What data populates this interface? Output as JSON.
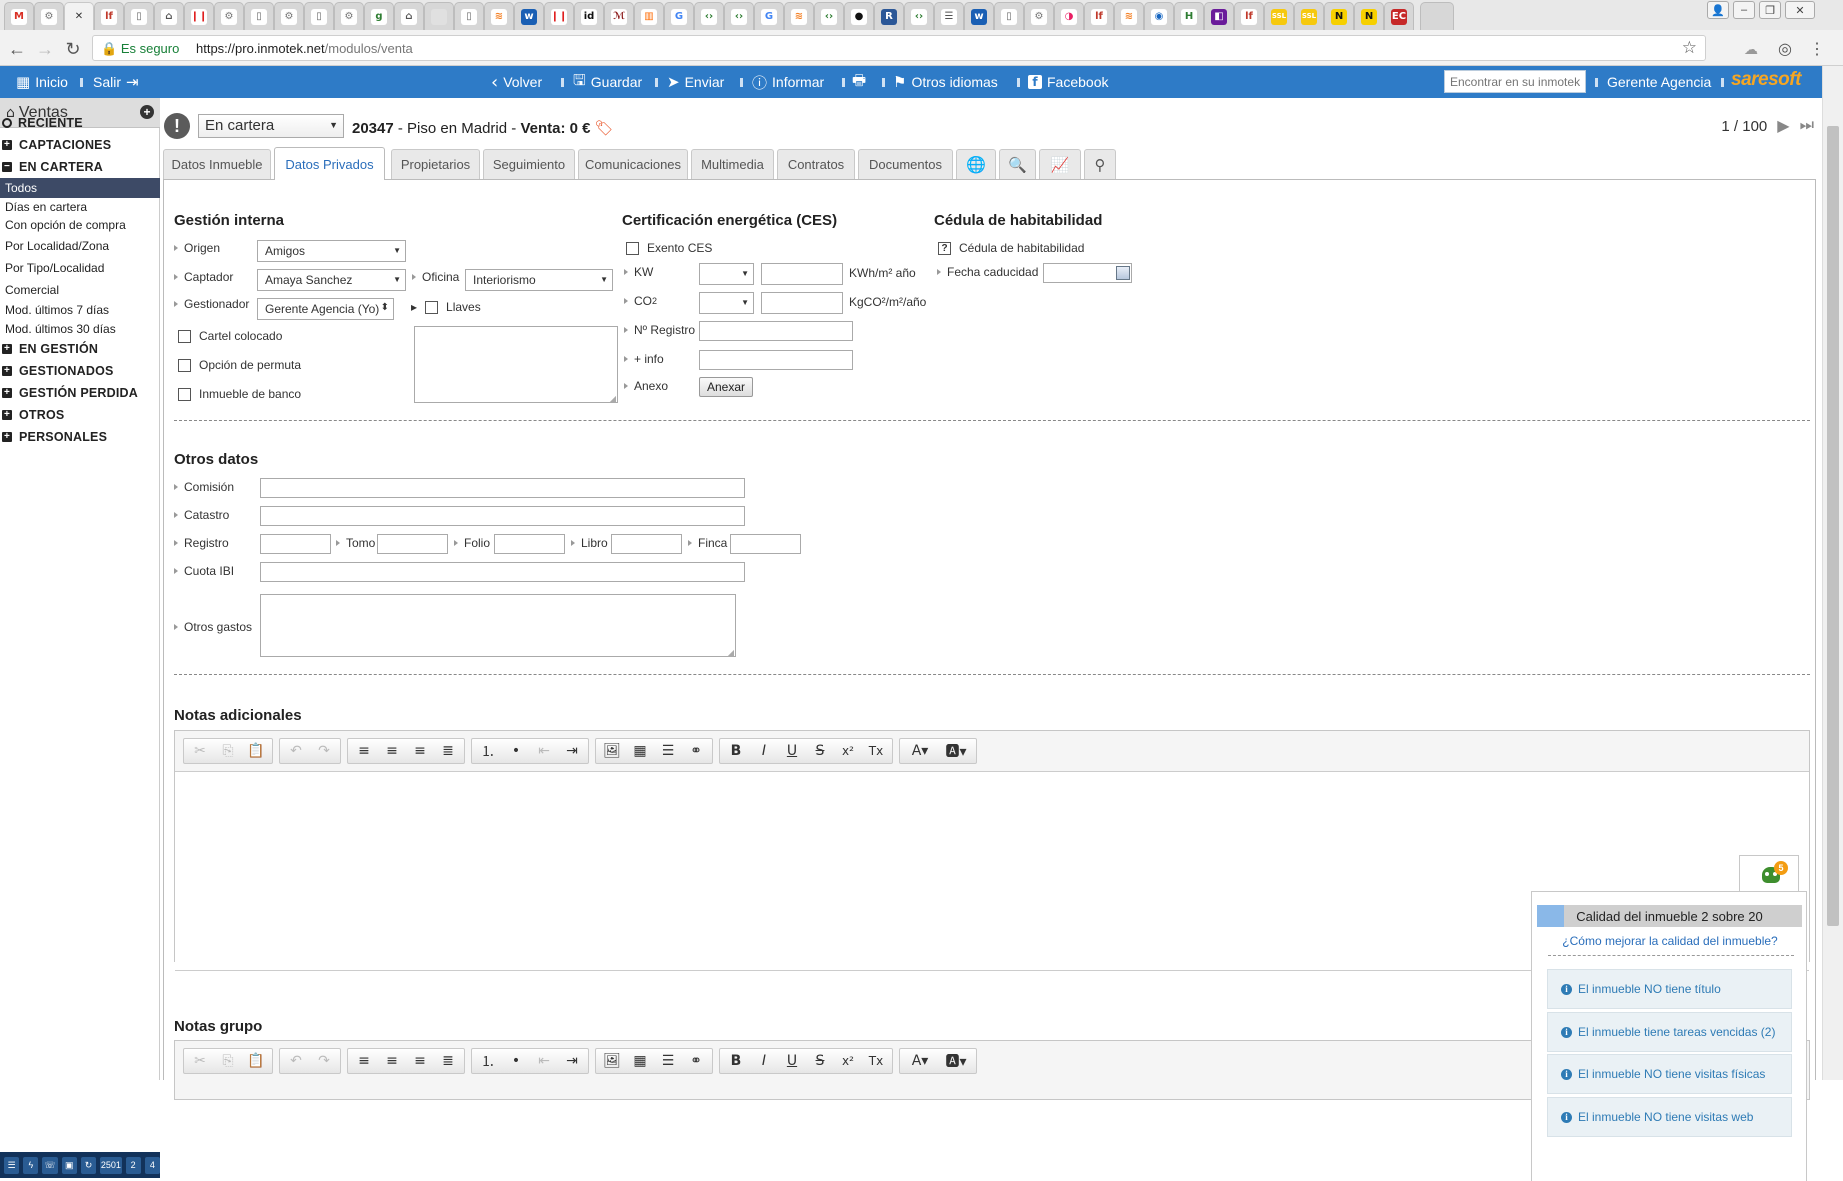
{
  "browser": {
    "tabs": [
      {
        "glyph": "M",
        "bg": "#ffffff",
        "fg": "#d93025"
      },
      {
        "glyph": "⚙",
        "bg": "#ffffff",
        "fg": "#777777"
      },
      {
        "glyph": "✕",
        "bg": "#f2f2f2",
        "fg": "#333333",
        "active": true
      },
      {
        "glyph": "lf",
        "bg": "#ffffff",
        "fg": "#c0392b"
      },
      {
        "glyph": "▯",
        "bg": "#ffffff",
        "fg": "#666666"
      },
      {
        "glyph": "⌂",
        "bg": "#ffffff",
        "fg": "#555555"
      },
      {
        "glyph": "❙❙",
        "bg": "#ffffff",
        "fg": "#e02020"
      },
      {
        "glyph": "⚙",
        "bg": "#ffffff",
        "fg": "#777777"
      },
      {
        "glyph": "▯",
        "bg": "#ffffff",
        "fg": "#666666"
      },
      {
        "glyph": "⚙",
        "bg": "#ffffff",
        "fg": "#777777"
      },
      {
        "glyph": "▯",
        "bg": "#ffffff",
        "fg": "#666666"
      },
      {
        "glyph": "⚙",
        "bg": "#ffffff",
        "fg": "#777777"
      },
      {
        "glyph": "g",
        "bg": "#ffffff",
        "fg": "#2e7d32"
      },
      {
        "glyph": "⌂",
        "bg": "#ffffff",
        "fg": "#555555"
      },
      {
        "glyph": " ",
        "bg": "#e0e0e0",
        "fg": "#555555"
      },
      {
        "glyph": "▯",
        "bg": "#ffffff",
        "fg": "#666666"
      },
      {
        "glyph": "≋",
        "bg": "#ffffff",
        "fg": "#f48024"
      },
      {
        "glyph": "w",
        "bg": "#1a5fb4",
        "fg": "#ffffff"
      },
      {
        "glyph": "❙❙",
        "bg": "#ffffff",
        "fg": "#e02020"
      },
      {
        "glyph": "id",
        "bg": "#ffffff",
        "fg": "#111111"
      },
      {
        "glyph": "ℳ",
        "bg": "#ffffff",
        "fg": "#8b1a1a"
      },
      {
        "glyph": "▥",
        "bg": "#ffffff",
        "fg": "#ff6a00"
      },
      {
        "glyph": "G",
        "bg": "#ffffff",
        "fg": "#4285f4"
      },
      {
        "glyph": "‹›",
        "bg": "#ffffff",
        "fg": "#2e7d32"
      },
      {
        "glyph": "‹›",
        "bg": "#ffffff",
        "fg": "#2e7d32"
      },
      {
        "glyph": "G",
        "bg": "#ffffff",
        "fg": "#4285f4"
      },
      {
        "glyph": "≋",
        "bg": "#ffffff",
        "fg": "#f48024"
      },
      {
        "glyph": "‹›",
        "bg": "#ffffff",
        "fg": "#2e7d32"
      },
      {
        "glyph": "●",
        "bg": "#ffffff",
        "fg": "#111111"
      },
      {
        "glyph": "R",
        "bg": "#2b5797",
        "fg": "#ffffff"
      },
      {
        "glyph": "‹›",
        "bg": "#ffffff",
        "fg": "#2e7d32"
      },
      {
        "glyph": "☰",
        "bg": "#ffffff",
        "fg": "#555555"
      },
      {
        "glyph": "w",
        "bg": "#1a5fb4",
        "fg": "#ffffff"
      },
      {
        "glyph": "▯",
        "bg": "#ffffff",
        "fg": "#666666"
      },
      {
        "glyph": "⚙",
        "bg": "#ffffff",
        "fg": "#777777"
      },
      {
        "glyph": "◑",
        "bg": "#ffffff",
        "fg": "#e91e63"
      },
      {
        "glyph": "lf",
        "bg": "#ffffff",
        "fg": "#c0392b"
      },
      {
        "glyph": "≋",
        "bg": "#ffffff",
        "fg": "#f48024"
      },
      {
        "glyph": "◉",
        "bg": "#ffffff",
        "fg": "#1565c0"
      },
      {
        "glyph": "H",
        "bg": "#ffffff",
        "fg": "#2e7d32"
      },
      {
        "glyph": "◧",
        "bg": "#6a1b9a",
        "fg": "#ffffff"
      },
      {
        "glyph": "lf",
        "bg": "#ffffff",
        "fg": "#c0392b"
      },
      {
        "glyph": "SSL",
        "bg": "#f6c90e",
        "fg": "#ffffff"
      },
      {
        "glyph": "SSL",
        "bg": "#f6c90e",
        "fg": "#ffffff"
      },
      {
        "glyph": "N",
        "bg": "#f6d000",
        "fg": "#111111"
      },
      {
        "glyph": "N",
        "bg": "#f6d000",
        "fg": "#111111"
      },
      {
        "glyph": "EC",
        "bg": "#c62828",
        "fg": "#ffffff"
      }
    ],
    "secure_label": "Es seguro",
    "url": "https://pro.inmotek.net/modulos/venta",
    "url_host": "https://pro.inmotek.net",
    "url_path": "/modulos/venta"
  },
  "appbar": {
    "inicio": "Inicio",
    "salir": "Salir",
    "volver": "Volver",
    "guardar": "Guardar",
    "enviar": "Enviar",
    "informar": "Informar",
    "otros_idiomas": "Otros idiomas",
    "facebook": "Facebook",
    "search_placeholder": "Encontrar en su inmotek",
    "user": "Gerente Agencia",
    "logo": "saresoft",
    "color": "#2e7bc7"
  },
  "sidebar": {
    "title": "Ventas",
    "items": [
      {
        "label": "RECIENTE",
        "kind": "sec",
        "icon": "circle"
      },
      {
        "label": "CAPTACIONES",
        "kind": "sec",
        "icon": "plus"
      },
      {
        "label": "EN CARTERA",
        "kind": "sec",
        "icon": "minus"
      },
      {
        "label": "Todos",
        "kind": "sub",
        "active": true
      },
      {
        "label": "Días en cartera",
        "kind": "sub"
      },
      {
        "label": "Con opción de compra",
        "kind": "sub"
      },
      {
        "label": "Por Localidad/Zona",
        "kind": "sub"
      },
      {
        "label": "Por Tipo/Localidad",
        "kind": "sub"
      },
      {
        "label": "Comercial",
        "kind": "sub"
      },
      {
        "label": "Mod. últimos 7 días",
        "kind": "sub"
      },
      {
        "label": "Mod. últimos 30 días",
        "kind": "sub"
      },
      {
        "label": "EN GESTIÓN",
        "kind": "sec",
        "icon": "plus"
      },
      {
        "label": "GESTIONADOS",
        "kind": "sec",
        "icon": "plus"
      },
      {
        "label": "GESTIÓN PERDIDA",
        "kind": "sec",
        "icon": "plus"
      },
      {
        "label": "OTROS",
        "kind": "sec",
        "icon": "plus"
      },
      {
        "label": "PERSONALES",
        "kind": "sec",
        "icon": "plus"
      }
    ],
    "taskbar": [
      "☰",
      "ϟ",
      "☏",
      "▣",
      "↻",
      "2501",
      "2",
      "4"
    ]
  },
  "property": {
    "status": "En cartera",
    "ref": "20347",
    "desc": "- Piso en Madrid -",
    "venta_label": "Venta:",
    "venta_value": "0 €",
    "pager": "1 / 100"
  },
  "tabs": [
    "Datos Inmueble",
    "Datos Privados",
    "Propietarios",
    "Seguimiento",
    "Comunicaciones",
    "Multimedia",
    "Contratos",
    "Documentos"
  ],
  "gestion": {
    "title": "Gestión interna",
    "origen_label": "Origen",
    "origen_value": "Amigos",
    "captador_label": "Captador",
    "captador_value": "Amaya Sanchez",
    "gestionador_label": "Gestionador",
    "gestionador_value": "Gerente Agencia (Yo)",
    "oficina_label": "Oficina",
    "oficina_value": "Interiorismo",
    "llaves_label": "Llaves",
    "cartel_label": "Cartel colocado",
    "permuta_label": "Opción de permuta",
    "banco_label": "Inmueble de banco"
  },
  "ces": {
    "title": "Certificación energética (CES)",
    "exento_label": "Exento CES",
    "kw_label": "KW",
    "kw_unit": "KWh/m² año",
    "co2_label": "CO",
    "co2_sub": "2",
    "co2_unit": "KgCO²/m²/año",
    "registro_label": "Nº Registro",
    "info_label": "+ info",
    "anexo_label": "Anexo",
    "anexar_button": "Anexar"
  },
  "cedula": {
    "title": "Cédula de habitabilidad",
    "check_label": "Cédula de habitabilidad",
    "caducidad_label": "Fecha caducidad"
  },
  "otros": {
    "title": "Otros datos",
    "comision": "Comisión",
    "catastro": "Catastro",
    "registro": "Registro",
    "tomo": "Tomo",
    "folio": "Folio",
    "libro": "Libro",
    "finca": "Finca",
    "cuota": "Cuota IBI",
    "gastos": "Otros gastos"
  },
  "notas": {
    "adicionales_title": "Notas adicionales",
    "grupo_title": "Notas grupo"
  },
  "quality": {
    "robot_badge": "5",
    "title": "Calidad del inmueble 2 sobre 20",
    "score": 2,
    "max": 20,
    "link": "¿Cómo mejorar la calidad del inmueble?",
    "items": [
      "El inmueble NO tiene título",
      "El inmueble tiene tareas vencidas (2)",
      "El inmueble NO tiene visitas físicas",
      "El inmueble NO tiene visitas web"
    ]
  }
}
